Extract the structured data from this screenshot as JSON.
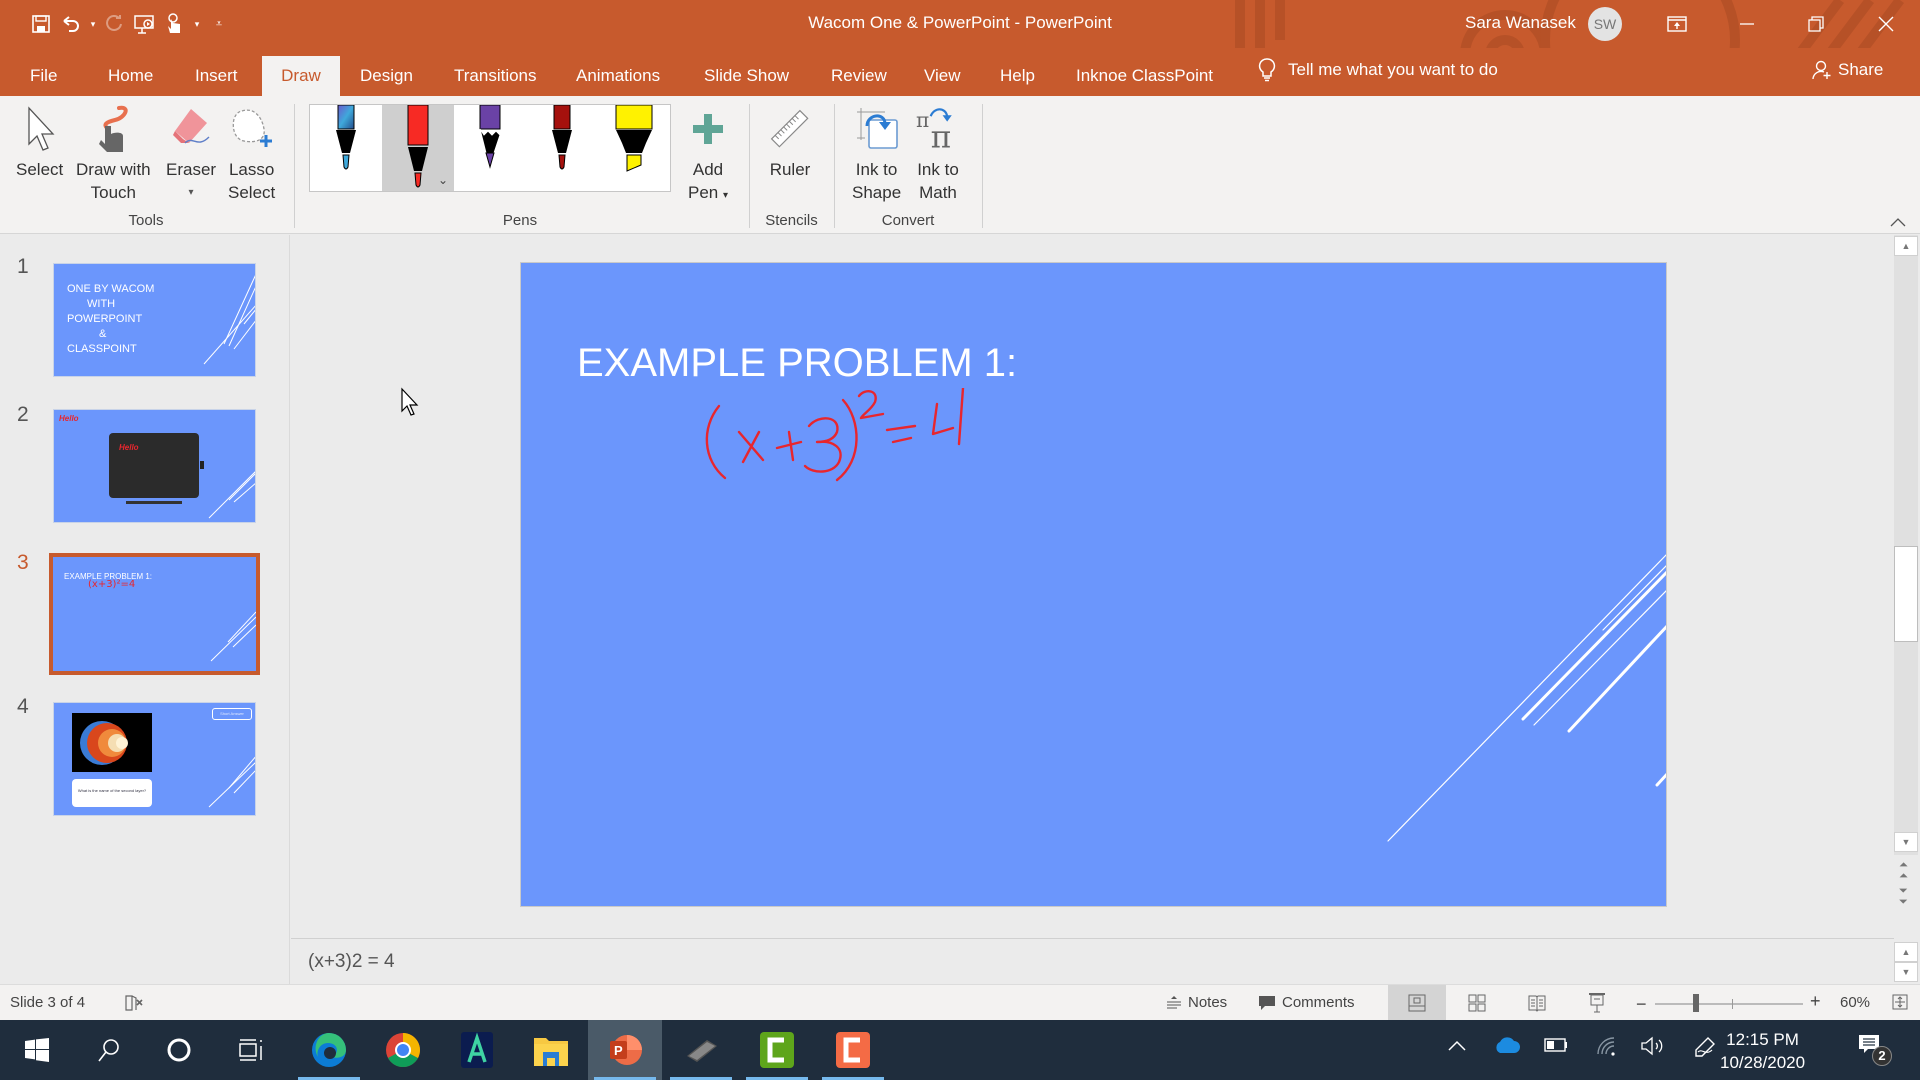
{
  "window": {
    "title": "Wacom One & PowerPoint  -  PowerPoint",
    "user_name": "Sara Wanasek",
    "user_initials": "SW",
    "accent_color": "#c75a2d"
  },
  "quick_access": [
    {
      "icon": "save-icon"
    },
    {
      "icon": "undo-icon"
    },
    {
      "icon": "redo-icon"
    },
    {
      "icon": "present-from-beginning-icon"
    },
    {
      "icon": "touch-mouse-mode-icon"
    },
    {
      "icon": "customize-qat-icon"
    }
  ],
  "tabs": [
    {
      "label": "File"
    },
    {
      "label": "Home"
    },
    {
      "label": "Insert"
    },
    {
      "label": "Draw",
      "active": true
    },
    {
      "label": "Design"
    },
    {
      "label": "Transitions"
    },
    {
      "label": "Animations"
    },
    {
      "label": "Slide Show"
    },
    {
      "label": "Review"
    },
    {
      "label": "View"
    },
    {
      "label": "Help"
    },
    {
      "label": "Inknoe ClassPoint"
    }
  ],
  "tell_me": "Tell me what you want to do",
  "share": "Share",
  "ribbon": {
    "tools": {
      "group_label": "Tools",
      "select": "Select",
      "draw_touch_1": "Draw with",
      "draw_touch_2": "Touch",
      "eraser": "Eraser",
      "lasso_1": "Lasso",
      "lasso_2": "Select"
    },
    "pens": {
      "group_label": "Pens",
      "items": [
        {
          "name": "galaxy-pen",
          "color": "#3fa9db"
        },
        {
          "name": "red-pen",
          "color": "#f72a24",
          "selected": true
        },
        {
          "name": "purple-pencil",
          "color": "#6a42a6"
        },
        {
          "name": "dark-red-pen",
          "color": "#a5110d"
        },
        {
          "name": "yellow-highlighter",
          "color": "#fff200"
        }
      ],
      "add_pen_1": "Add",
      "add_pen_2": "Pen"
    },
    "stencils": {
      "group_label": "Stencils",
      "ruler": "Ruler"
    },
    "convert": {
      "group_label": "Convert",
      "ink_shape_1": "Ink to",
      "ink_shape_2": "Shape",
      "ink_math_1": "Ink to",
      "ink_math_2": "Math"
    }
  },
  "slides": [
    {
      "number": "1",
      "lines": [
        "ONE BY WACOM",
        "WITH",
        "POWERPOINT",
        "&",
        "CLASSPOINT"
      ]
    },
    {
      "number": "2",
      "ink": "Hello"
    },
    {
      "number": "3",
      "title": "EXAMPLE PROBLEM 1:",
      "ink": "(x+3)²=4",
      "active": true
    },
    {
      "number": "4",
      "caption": "What is the name of the second layer?",
      "button": "Short Answer"
    }
  ],
  "current_slide": {
    "title": "EXAMPLE PROBLEM 1:",
    "ink_equation": "(x+3)²=4",
    "background": "#6b96fc",
    "ink_color": "#e8262e"
  },
  "notes": "(x+3)2 = 4",
  "status": {
    "slide_indicator": "Slide 3 of 4",
    "notes_label": "Notes",
    "comments_label": "Comments",
    "zoom_percent": "60%",
    "zoom_value": 60
  },
  "taskbar": {
    "apps": [
      {
        "name": "microsoft-edge"
      },
      {
        "name": "google-chrome"
      },
      {
        "name": "app-a"
      },
      {
        "name": "file-explorer"
      },
      {
        "name": "powerpoint",
        "active": true
      },
      {
        "name": "wacom-tablet"
      },
      {
        "name": "camtasia-green"
      },
      {
        "name": "camtasia-orange"
      }
    ],
    "time": "12:15 PM",
    "date": "10/28/2020",
    "notification_count": "2"
  }
}
